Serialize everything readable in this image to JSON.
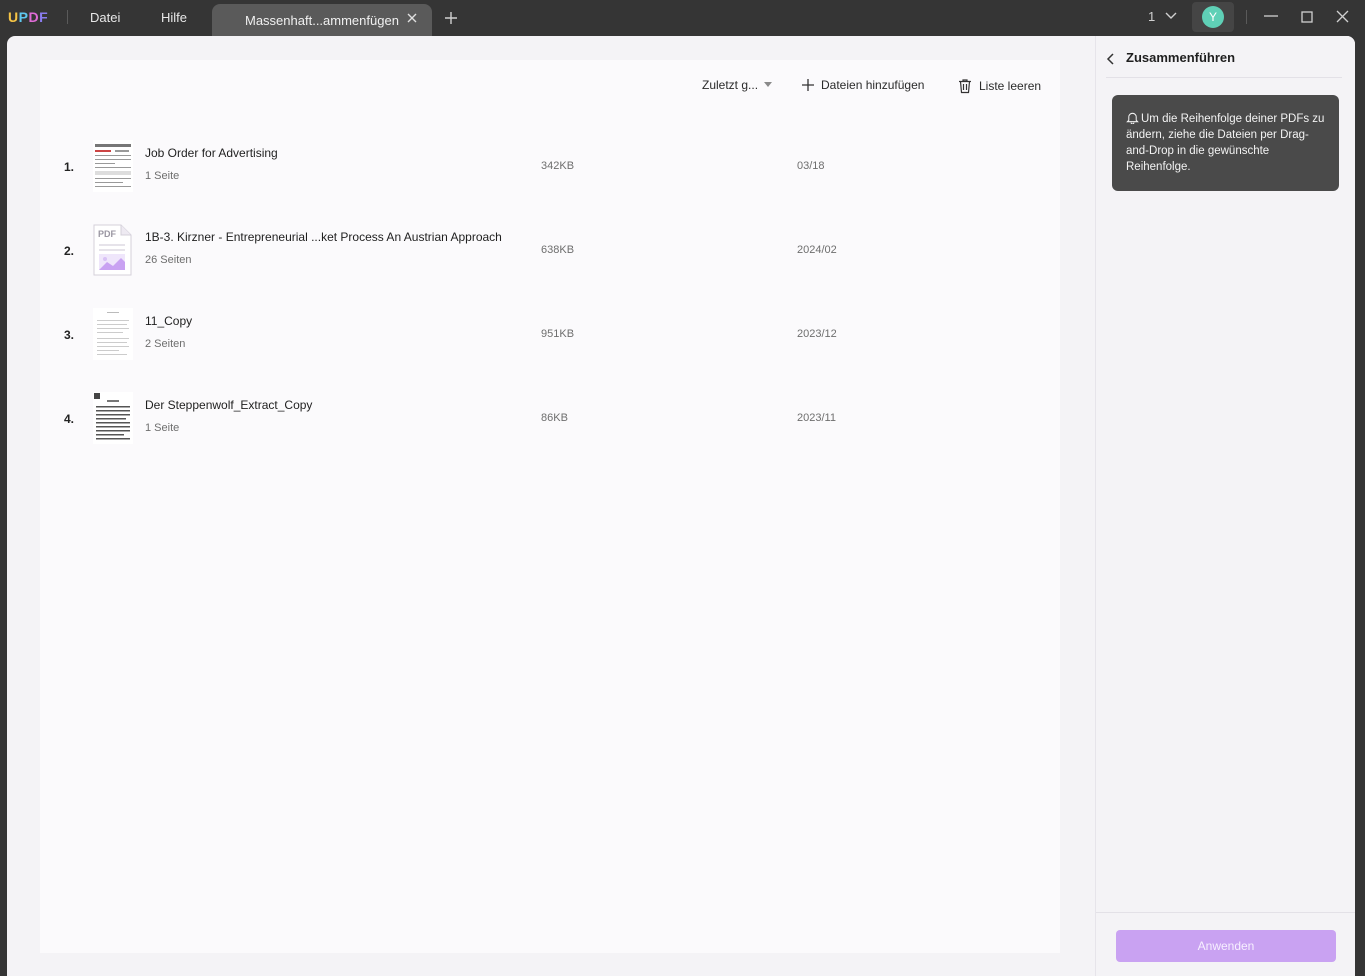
{
  "app": {
    "logo": [
      "U",
      "P",
      "D",
      "F"
    ],
    "menu": [
      "Datei",
      "Hilfe"
    ],
    "tab_title": "Massenhaft...ammenfügen",
    "page_count": "1",
    "avatar_letter": "Y"
  },
  "toolbar": {
    "sort_label": "Zuletzt g...",
    "add_files_label": "Dateien hinzufügen",
    "clear_list_label": "Liste leeren"
  },
  "files": [
    {
      "num": "1.",
      "title": "Job Order for Advertising",
      "pages": "1 Seite",
      "size": "342KB",
      "date": "03/18",
      "thumb": "form"
    },
    {
      "num": "2.",
      "title": "1B-3. Kirzner - Entrepreneurial ...ket Process An Austrian Approach",
      "pages": "26 Seiten",
      "size": "638KB",
      "date": "2024/02",
      "thumb": "pdf"
    },
    {
      "num": "3.",
      "title": "11_Copy",
      "pages": "2 Seiten",
      "size": "951KB",
      "date": "2023/12",
      "thumb": "text-light"
    },
    {
      "num": "4.",
      "title": "Der Steppenwolf_Extract_Copy",
      "pages": "1 Seite",
      "size": "86KB",
      "date": "2023/11",
      "thumb": "text-dense"
    }
  ],
  "panel": {
    "title": "Zusammenführen",
    "hint": "Um die Reihenfolge deiner PDFs zu ändern, ziehe die Dateien per Drag-and-Drop in die gewünschte Reihenfolge.",
    "apply_label": "Anwenden"
  },
  "colors": {
    "accent": "#c9a2f2",
    "avatar": "#5fd0b6"
  }
}
